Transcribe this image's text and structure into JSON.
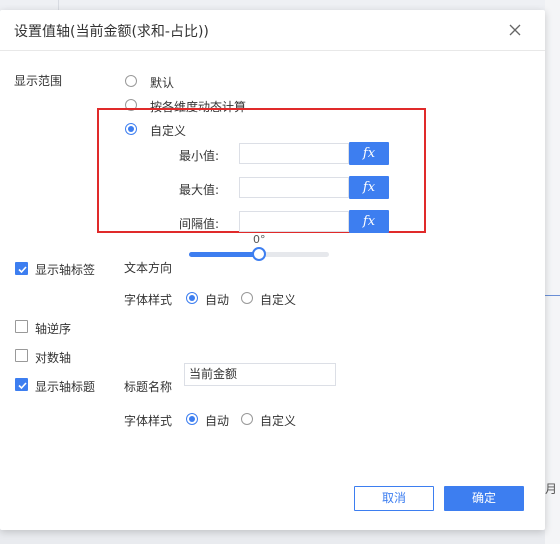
{
  "dialog": {
    "title": "设置值轴(当前金额(求和-占比))"
  },
  "display_range": {
    "label": "显示范围",
    "options": [
      {
        "label": "默认",
        "selected": false
      },
      {
        "label": "按各维度动态计算",
        "selected": false
      },
      {
        "label": "自定义",
        "selected": true
      }
    ],
    "min_label": "最小值:",
    "max_label": "最大值:",
    "interval_label": "间隔值:",
    "min_value": "",
    "max_value": "",
    "interval_value": "",
    "fx_label": "fx"
  },
  "axis_labels": {
    "checkbox_label": "显示轴标签",
    "checked": true,
    "text_direction_label": "文本方向",
    "angle_text": "0°",
    "angle_fraction": 0.5,
    "font_style_label": "字体样式",
    "font_options": [
      {
        "label": "自动",
        "selected": true
      },
      {
        "label": "自定义",
        "selected": false
      }
    ]
  },
  "reverse_axis": {
    "label": "轴逆序",
    "checked": false
  },
  "log_axis": {
    "label": "对数轴",
    "checked": false
  },
  "axis_title": {
    "checkbox_label": "显示轴标题",
    "checked": true,
    "title_name_label": "标题名称",
    "title_value": "当前金额",
    "font_style_label": "字体样式",
    "font_options": [
      {
        "label": "自动",
        "selected": true
      },
      {
        "label": "自定义",
        "selected": false
      }
    ]
  },
  "footer": {
    "cancel_label": "取消",
    "ok_label": "确定"
  },
  "background": {
    "month_glyph": "月"
  },
  "colors": {
    "accent": "#3d7ef0",
    "highlight_border": "#e02a2a"
  }
}
